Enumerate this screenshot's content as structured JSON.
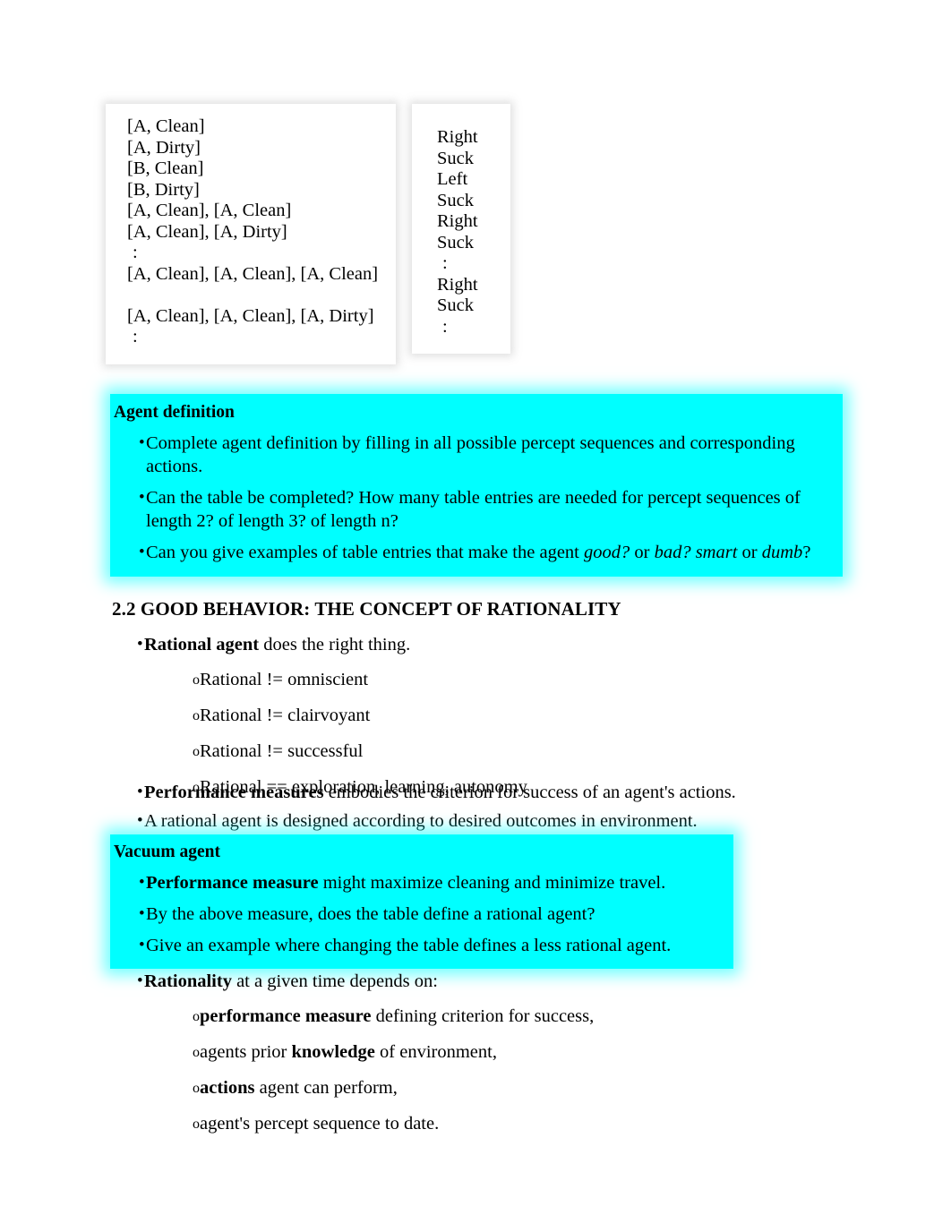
{
  "table": {
    "percept_column": [
      "[A, Clean]",
      "[A, Dirty]",
      "[B, Clean]",
      "[B, Dirty]",
      "[A, Clean], [A, Clean]",
      "[A, Clean], [A, Dirty]",
      ":",
      "[A, Clean], [A, Clean], [A, Clean]",
      "",
      "[A, Clean], [A, Clean], [A, Dirty]",
      ":"
    ],
    "action_column": [
      "Right",
      "Suck",
      "Left",
      "Suck",
      "Right",
      "Suck",
      ":",
      "Right",
      "Suck",
      ":"
    ]
  },
  "agent_definition_box": {
    "title": "Agent definition",
    "bullets": [
      {
        "runs": [
          {
            "t": "Complete agent definition by filling in all possible percept sequences and corresponding actions.",
            "s": "n"
          }
        ]
      },
      {
        "runs": [
          {
            "t": "Can the table be completed? How many table entries are needed for percept sequences of length 2? of length 3? of length n?",
            "s": "n"
          }
        ]
      },
      {
        "runs": [
          {
            "t": "Can you give examples of table entries that make the agent ",
            "s": "n"
          },
          {
            "t": "good?",
            "s": "i"
          },
          {
            "t": " or ",
            "s": "n"
          },
          {
            "t": "bad? smart",
            "s": "i"
          },
          {
            "t": " or ",
            "s": "n"
          },
          {
            "t": "dumb",
            "s": "i"
          },
          {
            "t": "?",
            "s": "n"
          }
        ]
      }
    ]
  },
  "section": {
    "heading": "2.2 GOOD BEHAVIOR: THE CONCEPT OF RATIONALITY"
  },
  "rational_block": {
    "lead": {
      "runs": [
        {
          "t": "Rational agent",
          "s": "b"
        },
        {
          "t": " does the right thing.",
          "s": "n"
        }
      ]
    },
    "sub_items": [
      {
        "runs": [
          {
            "t": "Rational != omniscient",
            "s": "n"
          }
        ]
      },
      {
        "runs": [
          {
            "t": "Rational != clairvoyant",
            "s": "n"
          }
        ]
      },
      {
        "runs": [
          {
            "t": "Rational != successful",
            "s": "n"
          }
        ]
      },
      {
        "runs": [
          {
            "t": "Rational == exploration, learning, autonomy",
            "s": "n"
          }
        ]
      }
    ]
  },
  "performance_block": {
    "bullets": [
      {
        "runs": [
          {
            "t": "Performance measures",
            "s": "b"
          },
          {
            "t": " embodies the criterion for success of an agent's actions.",
            "s": "n"
          }
        ]
      },
      {
        "runs": [
          {
            "t": "A rational agent is designed according to desired outcomes in environment.",
            "s": "n"
          }
        ]
      }
    ]
  },
  "vacuum_agent_box": {
    "title": "Vacuum agent",
    "bullets": [
      {
        "runs": [
          {
            "t": "Performance measure",
            "s": "b"
          },
          {
            "t": " might maximize cleaning and minimize travel.",
            "s": "n"
          }
        ]
      },
      {
        "runs": [
          {
            "t": "By the above measure, does the table define a rational agent?",
            "s": "n"
          }
        ]
      },
      {
        "runs": [
          {
            "t": "Give an example where changing the table defines a less rational agent.",
            "s": "n"
          }
        ]
      }
    ]
  },
  "rationality_block": {
    "lead": {
      "runs": [
        {
          "t": "Rationality",
          "s": "b"
        },
        {
          "t": " at a given time depends on:",
          "s": "n"
        }
      ]
    },
    "sub_items": [
      {
        "runs": [
          {
            "t": "performance measure",
            "s": "b"
          },
          {
            "t": " defining criterion for success,",
            "s": "n"
          }
        ]
      },
      {
        "runs": [
          {
            "t": "agents prior ",
            "s": "n"
          },
          {
            "t": "knowledge",
            "s": "b"
          },
          {
            "t": " of environment,",
            "s": "n"
          }
        ]
      },
      {
        "runs": [
          {
            "t": "actions",
            "s": "b"
          },
          {
            "t": " agent can perform,",
            "s": "n"
          }
        ]
      },
      {
        "runs": [
          {
            "t": "agent's percept sequence to date.",
            "s": "n"
          }
        ]
      }
    ]
  },
  "markers": {
    "bullet": "•",
    "circle": "o"
  },
  "colors": {
    "highlight": "#00FFFF",
    "text": "#000000",
    "page": "#FFFFFF"
  }
}
